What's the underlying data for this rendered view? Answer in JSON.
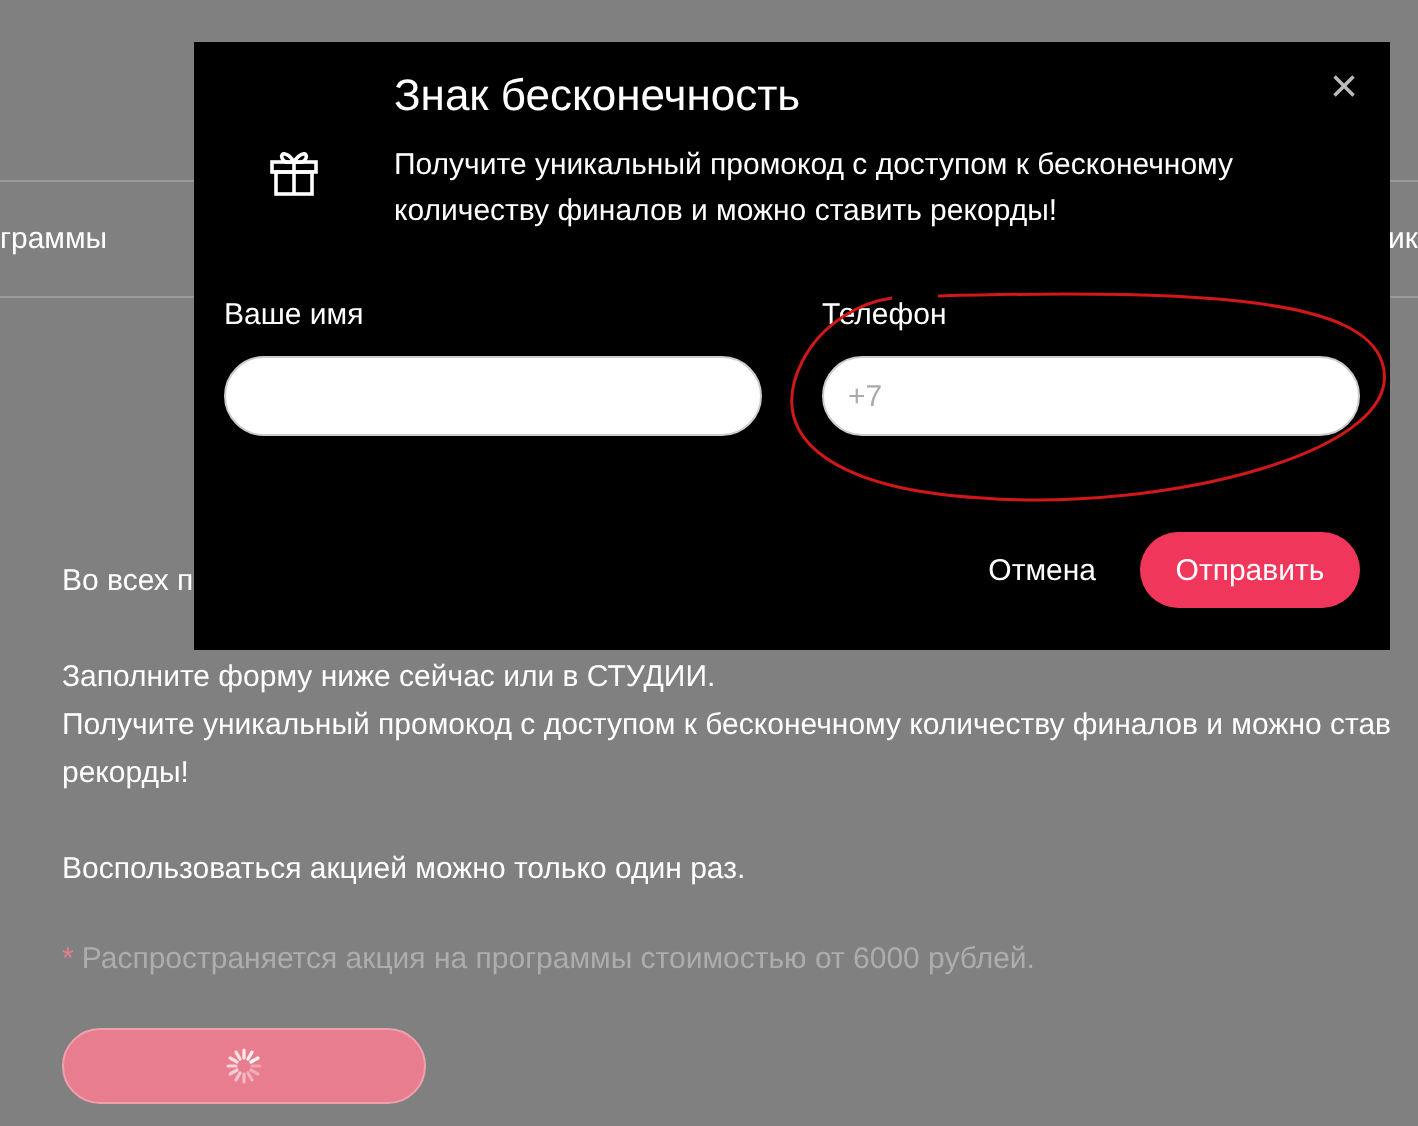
{
  "background": {
    "nav_left": "граммы",
    "nav_right": "ик",
    "paragraphs": [
      [
        "Во всех п"
      ],
      [
        "Заполните форму ниже сейчас или в СТУДИИ.",
        "Получите уникальный промокод с доступом к бесконечному количеству финалов и можно став",
        "рекорды!"
      ],
      [
        "Воспользоваться акцией можно только один раз."
      ]
    ],
    "footnote": {
      "mark": "*",
      "text": "Распространяется акция на программы стоимостью от 6000 рублей."
    },
    "submit": {
      "loading": true
    }
  },
  "modal": {
    "title": "Знак бесконечность",
    "description": "Получите уникальный промокод с доступом к бесконечному количеству финалов и можно ставить рекорды!",
    "close": "×",
    "fields": [
      {
        "label": "Ваше имя",
        "highlighted": false
      },
      {
        "label": "Телефон",
        "placeholder": "+7",
        "highlighted": true
      }
    ],
    "buttons": [
      {
        "label": "Отмена",
        "kind": "text"
      },
      {
        "label": "Отправить",
        "kind": "primary"
      }
    ]
  }
}
